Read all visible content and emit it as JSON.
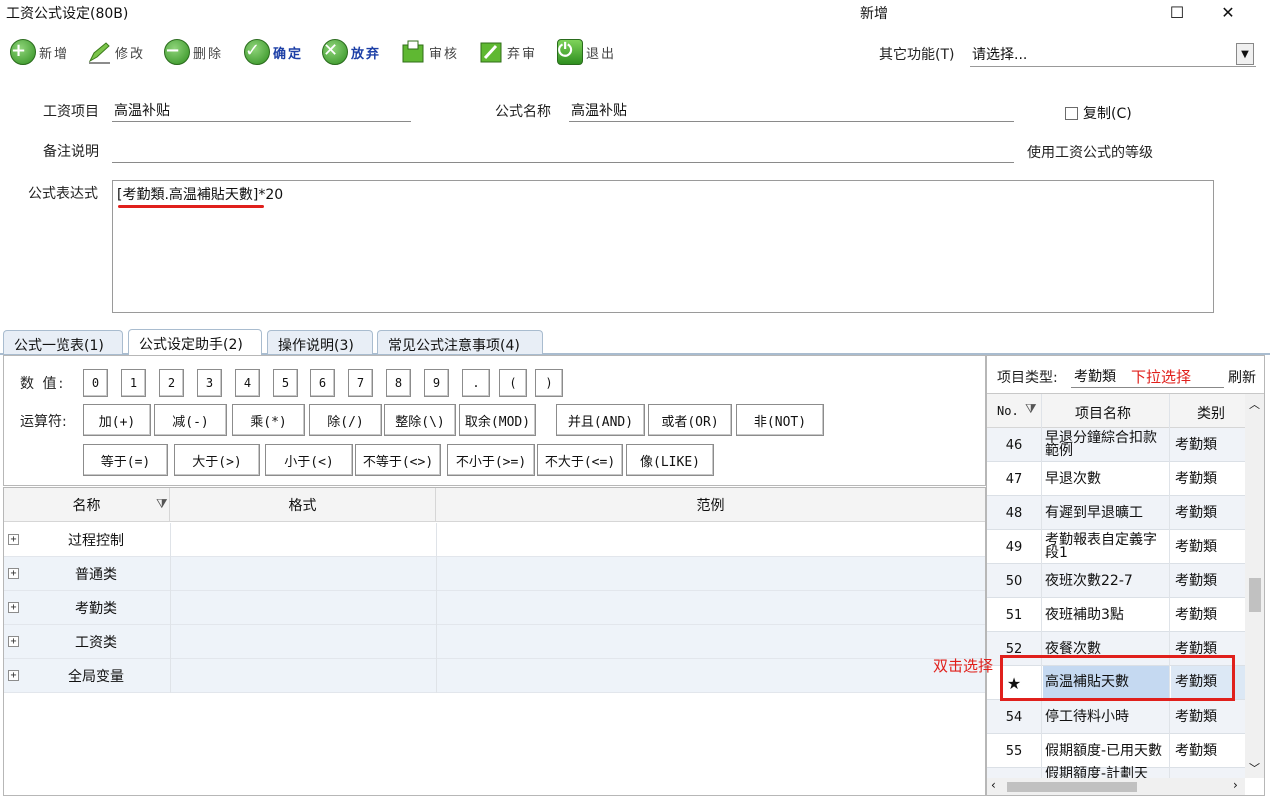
{
  "window": {
    "title": "工资公式设定(80B)",
    "mode": "新增",
    "maximize_glyph": "☐",
    "close_glyph": "✕"
  },
  "toolbar": {
    "items": [
      {
        "label": "新增",
        "icon": "add-icon"
      },
      {
        "label": "修改",
        "icon": "edit-icon"
      },
      {
        "label": "删除",
        "icon": "delete-icon"
      },
      {
        "label": "确定",
        "icon": "confirm-icon"
      },
      {
        "label": "放弃",
        "icon": "abandon-icon"
      },
      {
        "label": "审核",
        "icon": "audit-icon"
      },
      {
        "label": "弃审",
        "icon": "unaudit-icon"
      },
      {
        "label": "退出",
        "icon": "exit-icon"
      }
    ],
    "other_label": "其它功能(T)",
    "other_value": "请选择..."
  },
  "form": {
    "item_label": "工资项目",
    "item_value": "高温补贴",
    "formula_name_label": "公式名称",
    "formula_name_value": "高温补贴",
    "copy_label": "复制(C)",
    "remark_label": "备注说明",
    "remark_value": "",
    "level_label": "使用工资公式的等级",
    "expr_label": "公式表达式",
    "expr_highlight": "[考勤類.高温補貼天數]",
    "expr_rest": "*20"
  },
  "tabs": [
    "公式一览表(1)",
    "公式设定助手(2)",
    "操作说明(3)",
    "常见公式注意事项(4)"
  ],
  "operators": {
    "num_label": "数 值:",
    "numbers": [
      "0",
      "1",
      "2",
      "3",
      "4",
      "5",
      "6",
      "7",
      "8",
      "9",
      ".",
      "(",
      ")"
    ],
    "op_label": "运算符:",
    "row1": [
      "加(+)",
      "减(-)",
      "乘(*)",
      "除(/)",
      "整除(\\)",
      "取余(MOD)",
      "并且(AND)",
      "或者(OR)",
      "非(NOT)"
    ],
    "row2": [
      "等于(=)",
      "大于(>)",
      "小于(<)",
      "不等于(<>)",
      "不小于(>=)",
      "不大于(<=)",
      "像(LIKE)"
    ]
  },
  "grid": {
    "headers": [
      "名称",
      "格式",
      "范例"
    ],
    "rows": [
      "过程控制",
      "普通类",
      "考勤类",
      "工资类",
      "全局变量"
    ],
    "expander": "+",
    "filter_glyph": "⧩"
  },
  "right_panel": {
    "type_label": "项目类型:",
    "type_value": "考勤類",
    "dropdown_hint": "下拉选择",
    "refresh_label": "刷新",
    "headers": [
      "No.",
      "项目名称",
      "类别"
    ],
    "rows": [
      {
        "no": "46",
        "name": "早退分鐘綜合扣款範例",
        "cat": "考勤類"
      },
      {
        "no": "47",
        "name": "早退次數",
        "cat": "考勤類"
      },
      {
        "no": "48",
        "name": "有遲到早退曠工",
        "cat": "考勤類"
      },
      {
        "no": "49",
        "name": "考勤報表自定義字段1",
        "cat": "考勤類"
      },
      {
        "no": "50",
        "name": "夜班次數22-7",
        "cat": "考勤類"
      },
      {
        "no": "51",
        "name": "夜班補助3點",
        "cat": "考勤類"
      },
      {
        "no": "52",
        "name": "夜餐次數",
        "cat": "考勤類"
      },
      {
        "no": "★",
        "name": "高温補貼天數",
        "cat": "考勤類"
      },
      {
        "no": "54",
        "name": "停工待料小時",
        "cat": "考勤類"
      },
      {
        "no": "55",
        "name": "假期額度-已用天數",
        "cat": "考勤類"
      },
      {
        "no": "",
        "name": "假期額度-計劃天",
        "cat": ""
      }
    ],
    "dblclick_hint": "双击选择"
  },
  "colors": {
    "annotation_red": "#e0201c",
    "selected_row": "#c5d9f1",
    "tab_border": "#a9bccf"
  }
}
